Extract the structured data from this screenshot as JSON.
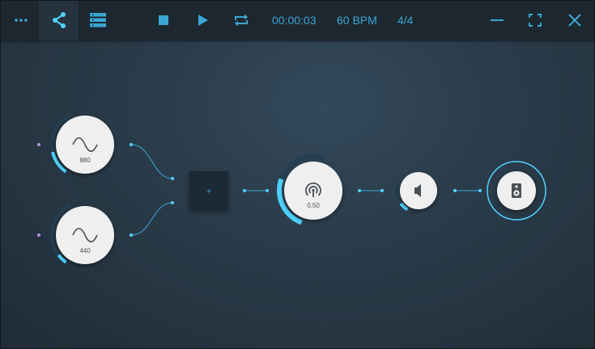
{
  "toolbar": {
    "menu_icon": "more-horizontal-icon",
    "share_icon": "share-icon",
    "list_icon": "list-icon",
    "stop_icon": "stop-icon",
    "play_icon": "play-icon",
    "loop_icon": "loop-icon",
    "time": "00:00:03",
    "tempo": "60 BPM",
    "signature": "4/4",
    "minimize_icon": "minimize-icon",
    "fullscreen_icon": "fullscreen-icon",
    "close_icon": "close-icon"
  },
  "nodes": {
    "osc1": {
      "icon": "sine-wave-icon",
      "label": "880",
      "level": 0.35
    },
    "osc2": {
      "icon": "sine-wave-icon",
      "label": "440",
      "level": 0.15
    },
    "mixer": {
      "label": "+"
    },
    "delay": {
      "icon": "broadcast-icon",
      "label": "0.50",
      "level": 0.5
    },
    "volume": {
      "icon": "speaker-volume-icon",
      "level": 0.3
    },
    "output": {
      "icon": "loudspeaker-icon"
    }
  },
  "colors": {
    "accent": "#3aa6d4",
    "accent_bright": "#4fd2ff",
    "arc_dark": "#243e52",
    "node_fill": "#efefef",
    "topbar": "#1d272f",
    "input_port": "#b794e8"
  }
}
